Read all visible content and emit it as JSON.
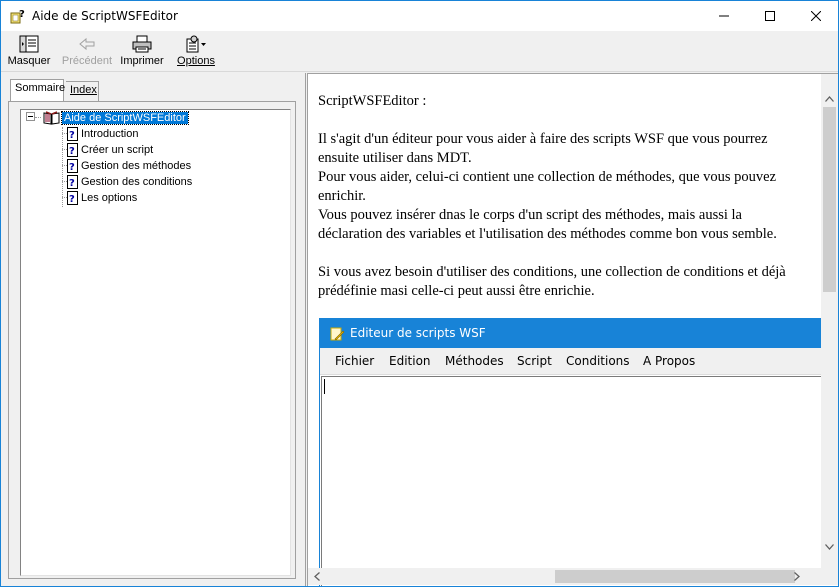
{
  "window": {
    "title": "Aide de ScriptWSFEditor"
  },
  "toolbar": {
    "hide_label": "Masquer",
    "back_label": "Précédent",
    "print_label": "Imprimer",
    "options_label": "Options"
  },
  "nav": {
    "tabs": [
      {
        "label": "Sommaire",
        "active": true
      },
      {
        "label": "Index",
        "active": false
      }
    ],
    "tree": {
      "root": "Aide de ScriptWSFEditor",
      "items": [
        {
          "label": "Introduction"
        },
        {
          "label": "Créer un script"
        },
        {
          "label": "Gestion des méthodes"
        },
        {
          "label": "Gestion des conditions"
        },
        {
          "label": "Les options"
        }
      ]
    }
  },
  "content": {
    "heading": "ScriptWSFEditor :",
    "p1": "Il s'agit d'un éditeur pour vous aider à faire des scripts WSF que vous pourrez ensuite utiliser dans MDT.",
    "p2": "Pour vous aider, celui-ci contient une collection de méthodes, que vous pouvez enrichir.",
    "p3": "Vous pouvez insérer dnas le corps d'un script des méthodes, mais aussi la déclaration des variables et l'utilisation des méthodes comme bon vous semble.",
    "p4": "Si vous avez besoin d'utiliser des conditions, une collection de conditions et déjà prédéfinie masi celle-ci peut aussi être enrichie.",
    "embedded_app": {
      "title": "Editeur de scripts WSF",
      "menu": [
        "Fichier",
        "Edition",
        "Méthodes",
        "Script",
        "Conditions",
        "A Propos"
      ]
    }
  },
  "colors": {
    "accent": "#0078d7",
    "embed_titlebar": "#1883d7"
  }
}
